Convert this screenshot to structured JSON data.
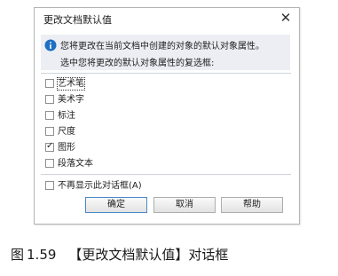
{
  "dialog": {
    "title": "更改文档默认值",
    "close_glyph": "✕",
    "info": {
      "icon": "info-icon",
      "line1": "您将更改在当前文档中创建的对象的默认对象属性。",
      "line2": "选中您将更改的默认对象属性的复选框:"
    },
    "options": [
      {
        "label": "艺术笔",
        "checked": false
      },
      {
        "label": "美术字",
        "checked": false
      },
      {
        "label": "标注",
        "checked": false
      },
      {
        "label": "尺度",
        "checked": false
      },
      {
        "label": "图形",
        "checked": true
      },
      {
        "label": "段落文本",
        "checked": false
      }
    ],
    "dont_show_again": {
      "label": "不再显示此对话框(A)",
      "checked": false
    },
    "buttons": {
      "ok": "确定",
      "cancel": "取消",
      "help": "帮助"
    }
  },
  "caption": {
    "figure": "图",
    "number": "1.59",
    "title": "【更改文档默认值】对话框"
  },
  "colors": {
    "info_panel_bg": "#eceef3",
    "info_icon": "#1f6fc4",
    "default_button_border": "#4a88c8"
  }
}
